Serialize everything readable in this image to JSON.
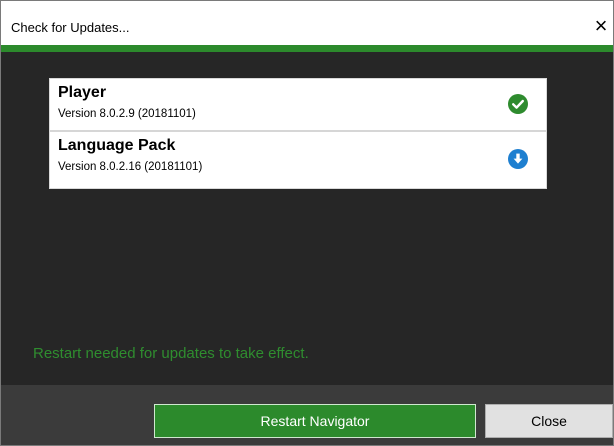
{
  "window": {
    "title": "Check for Updates...",
    "close_glyph": "×"
  },
  "updates": [
    {
      "name": "Player",
      "version": "Version 8.0.2.9 (20181101)",
      "status_icon": "checkmark-circle-icon"
    },
    {
      "name": "Language Pack",
      "version": "Version 8.0.2.16 (20181101)",
      "status_icon": "download-circle-icon"
    }
  ],
  "message": "Restart needed for updates to take effect.",
  "buttons": {
    "restart": "Restart Navigator",
    "close": "Close"
  },
  "colors": {
    "accent_green": "#2c8a2c",
    "download_blue": "#1e7fd0",
    "background": "#262626"
  }
}
